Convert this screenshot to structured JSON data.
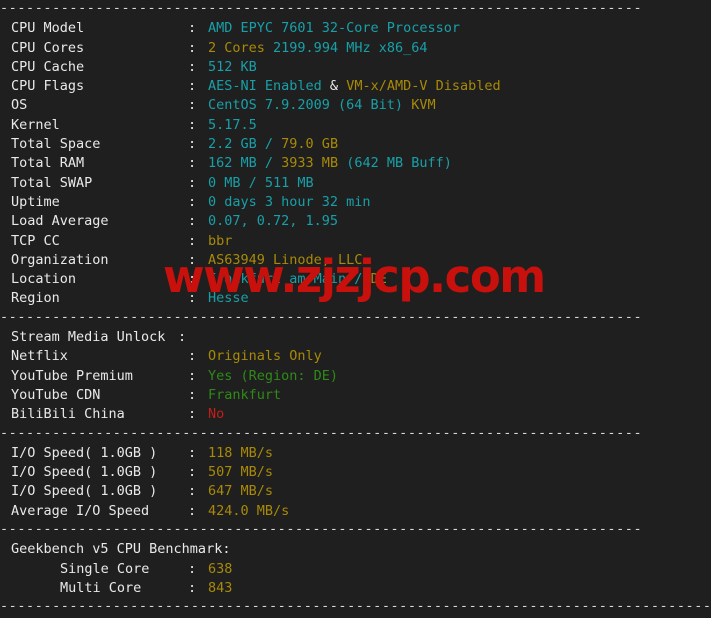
{
  "terminal": {
    "background_color": "#1f1f1f",
    "separator": "--------------------------------------------------------------------------",
    "separator_bottom": "-------------------------------------------------------------------------------------------------------",
    "colors": {
      "cyan": "#18a0a8",
      "gold": "#a88a06",
      "green": "#2f8a18",
      "red": "#c21f19",
      "text": "#e9e9e9",
      "watermark": "#c8100c"
    }
  },
  "watermark": {
    "text": "www.zjzjcp.com"
  },
  "system_info": {
    "rows": [
      {
        "label": "CPU Model",
        "colon": ":",
        "parts": [
          {
            "text": "AMD EPYC 7601 32-Core Processor",
            "color": "cyan"
          }
        ]
      },
      {
        "label": "CPU Cores",
        "colon": ":",
        "parts": [
          {
            "text": "2 Cores",
            "color": "gold"
          },
          {
            "text": " ",
            "color": "text"
          },
          {
            "text": "2199.994 MHz x86_64",
            "color": "cyan"
          }
        ]
      },
      {
        "label": "CPU Cache",
        "colon": ":",
        "parts": [
          {
            "text": "512 KB",
            "color": "cyan"
          }
        ]
      },
      {
        "label": "CPU Flags",
        "colon": ":",
        "parts": [
          {
            "text": "AES-NI Enabled",
            "color": "cyan"
          },
          {
            "text": " & ",
            "color": "text"
          },
          {
            "text": "VM-x/AMD-V Disabled",
            "color": "gold"
          }
        ]
      },
      {
        "label": "OS",
        "colon": ":",
        "parts": [
          {
            "text": "CentOS 7.9.2009 (64 Bit)",
            "color": "cyan"
          },
          {
            "text": " ",
            "color": "text"
          },
          {
            "text": "KVM",
            "color": "gold"
          }
        ]
      },
      {
        "label": "Kernel",
        "colon": ":",
        "parts": [
          {
            "text": "5.17.5",
            "color": "cyan"
          }
        ]
      },
      {
        "label": "Total Space",
        "colon": ":",
        "parts": [
          {
            "text": "2.2 GB",
            "color": "cyan"
          },
          {
            "text": " / ",
            "color": "cyan"
          },
          {
            "text": "79.0 GB",
            "color": "gold"
          }
        ]
      },
      {
        "label": "Total RAM",
        "colon": ":",
        "parts": [
          {
            "text": "162 MB",
            "color": "cyan"
          },
          {
            "text": " / ",
            "color": "cyan"
          },
          {
            "text": "3933 MB",
            "color": "gold"
          },
          {
            "text": " (642 MB Buff)",
            "color": "cyan"
          }
        ]
      },
      {
        "label": "Total SWAP",
        "colon": ":",
        "parts": [
          {
            "text": "0 MB / 511 MB",
            "color": "cyan"
          }
        ]
      },
      {
        "label": "Uptime",
        "colon": ":",
        "parts": [
          {
            "text": "0 days 3 hour 32 min",
            "color": "cyan"
          }
        ]
      },
      {
        "label": "Load Average",
        "colon": ":",
        "parts": [
          {
            "text": "0.07, 0.72, 1.95",
            "color": "cyan"
          }
        ]
      },
      {
        "label": "TCP CC",
        "colon": ":",
        "parts": [
          {
            "text": "bbr",
            "color": "gold"
          }
        ]
      },
      {
        "label": "Organization",
        "colon": ":",
        "parts": [
          {
            "text": "AS63949 Linode, LLC",
            "color": "gold"
          }
        ]
      },
      {
        "label": "Location",
        "colon": ":",
        "parts": [
          {
            "text": "Frankfurt am Main",
            "color": "cyan"
          },
          {
            "text": " / ",
            "color": "cyan"
          },
          {
            "text": "DE",
            "color": "gold"
          }
        ]
      },
      {
        "label": "Region",
        "colon": ":",
        "parts": [
          {
            "text": "Hesse",
            "color": "cyan"
          }
        ]
      }
    ]
  },
  "stream_media": {
    "section_label": "Stream Media Unlock",
    "section_colon": ":",
    "rows": [
      {
        "label": "Netflix",
        "colon": ":",
        "parts": [
          {
            "text": "Originals Only",
            "color": "gold"
          }
        ]
      },
      {
        "label": "YouTube Premium",
        "colon": ":",
        "parts": [
          {
            "text": "Yes (Region: DE)",
            "color": "green"
          }
        ]
      },
      {
        "label": "YouTube CDN",
        "colon": ":",
        "parts": [
          {
            "text": "Frankfurt",
            "color": "green"
          }
        ]
      },
      {
        "label": "BiliBili China",
        "colon": ":",
        "parts": [
          {
            "text": "No",
            "color": "red"
          }
        ]
      }
    ]
  },
  "io_speed": {
    "rows": [
      {
        "label": "I/O Speed( 1.0GB )",
        "colon": ":",
        "parts": [
          {
            "text": "118 MB/s",
            "color": "gold"
          }
        ]
      },
      {
        "label": "I/O Speed( 1.0GB )",
        "colon": ":",
        "parts": [
          {
            "text": "507 MB/s",
            "color": "gold"
          }
        ]
      },
      {
        "label": "I/O Speed( 1.0GB )",
        "colon": ":",
        "parts": [
          {
            "text": "647 MB/s",
            "color": "gold"
          }
        ]
      },
      {
        "label": "Average I/O Speed",
        "colon": ":",
        "parts": [
          {
            "text": "424.0 MB/s",
            "color": "gold"
          }
        ]
      }
    ]
  },
  "geekbench": {
    "heading": "Geekbench v5 CPU Benchmark:",
    "rows": [
      {
        "label": "Single Core",
        "colon": ":",
        "parts": [
          {
            "text": "638",
            "color": "gold"
          }
        ]
      },
      {
        "label": "Multi Core",
        "colon": ":",
        "parts": [
          {
            "text": "843",
            "color": "gold"
          }
        ]
      }
    ]
  }
}
